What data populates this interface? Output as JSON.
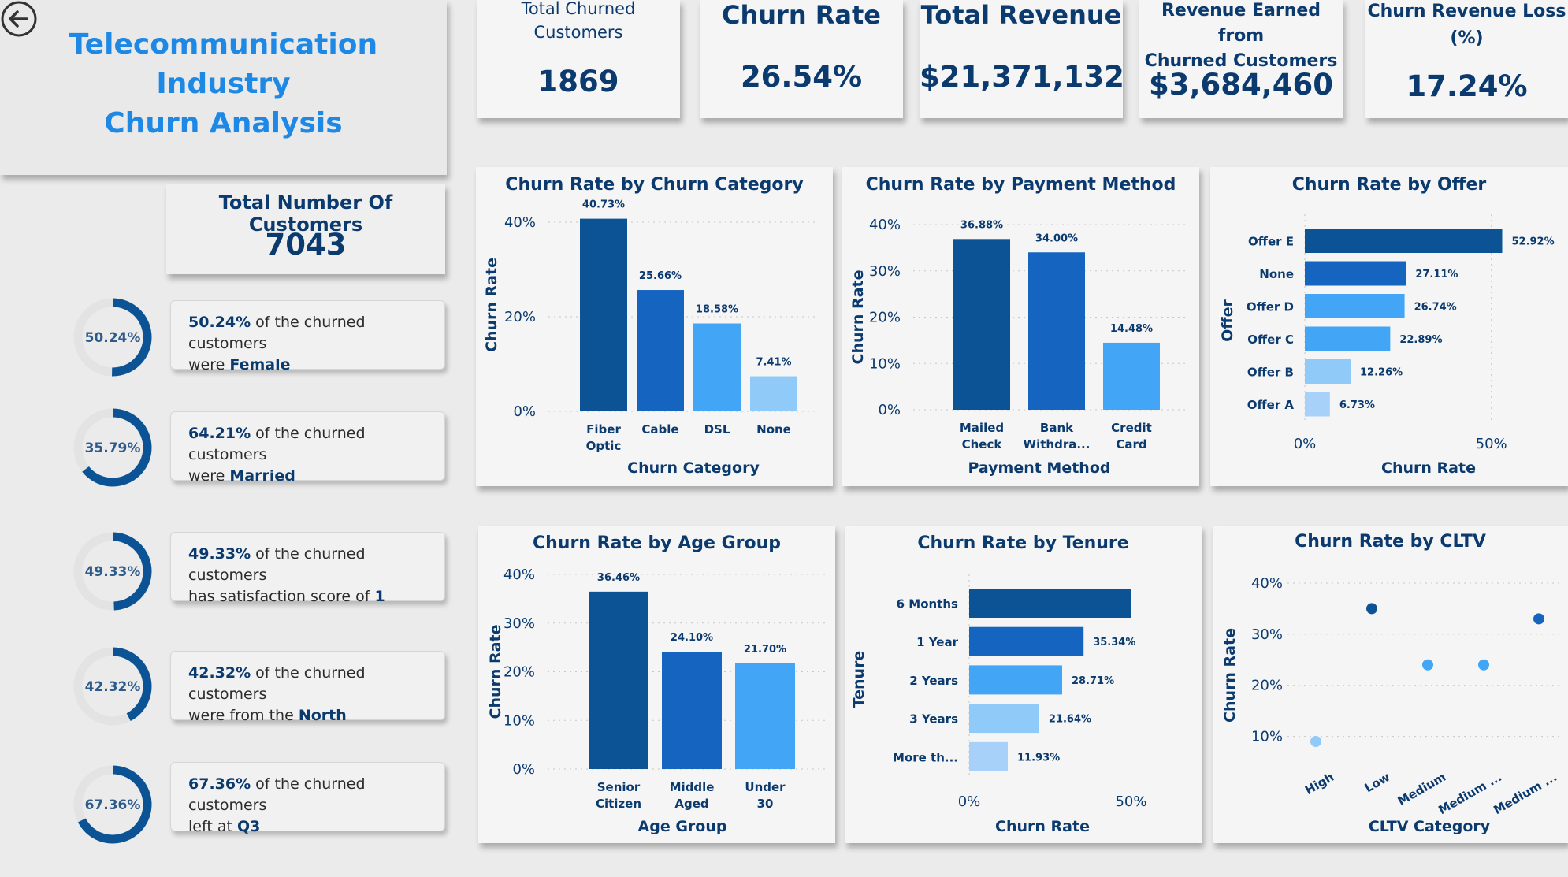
{
  "app": {
    "title_lines": [
      "Telecommunication",
      "Industry",
      "Churn Analysis"
    ]
  },
  "colors": {
    "c1": "#0b5394",
    "c2": "#1565c0",
    "c3": "#42a5f5",
    "c4": "#90caf9",
    "c5": "#a8d1fa",
    "ring": "#0b5394",
    "ring_track": "#e3e3e3",
    "title": "#1e88e5",
    "text": "#0b3a6e"
  },
  "kpis": [
    {
      "title": "Total Churned Customers",
      "title_lines": [
        "Total Churned",
        "Customers"
      ],
      "value": "1869"
    },
    {
      "title": "Churn Rate",
      "title_lines": [
        "Churn Rate"
      ],
      "value": "26.54%"
    },
    {
      "title": "Total Revenue",
      "title_lines": [
        "Total Revenue"
      ],
      "value": "$21,371,132"
    },
    {
      "title": "Revenue Earned from Churned Customers",
      "title_lines": [
        "Revenue Earned from",
        "Churned Customers"
      ],
      "value": "$3,684,460"
    },
    {
      "title": "Churn Revenue Loss (%)",
      "title_lines": [
        "Churn Revenue Loss",
        "(%)"
      ],
      "value": "17.24%"
    }
  ],
  "total_customers": {
    "title": "Total Number Of Customers",
    "value": "7043"
  },
  "insights": [
    {
      "ring_label": "50.24%",
      "ring_fraction": 0.5024,
      "pct": "50.24%",
      "text": "of the churned customers",
      "line2_prefix": "were",
      "highlight": "Female"
    },
    {
      "ring_label": "35.79%",
      "ring_fraction": 0.6421,
      "pct": "64.21%",
      "text": "of the churned customers",
      "line2_prefix": "were",
      "highlight": "Married"
    },
    {
      "ring_label": "49.33%",
      "ring_fraction": 0.4933,
      "pct": "49.33%",
      "text": "of the churned customers",
      "line2_prefix": "has satisfaction score of",
      "highlight": "1"
    },
    {
      "ring_label": "42.32%",
      "ring_fraction": 0.4232,
      "pct": "42.32%",
      "text": "of the churned customers",
      "line2_prefix": "were from the",
      "highlight": "North"
    },
    {
      "ring_label": "67.36%",
      "ring_fraction": 0.6736,
      "pct": "67.36%",
      "text": "of the churned customers",
      "line2_prefix": "left at",
      "highlight": "Q3"
    }
  ],
  "chart_data": [
    {
      "type": "bar",
      "title": "Churn Rate by Churn Category",
      "xlabel": "Churn Category",
      "ylabel": "Churn Rate",
      "categories": [
        "Fiber Optic",
        "Cable",
        "DSL",
        "None"
      ],
      "values": [
        40.73,
        25.66,
        18.58,
        7.41
      ],
      "data_labels": [
        "40.73%",
        "25.66%",
        "18.58%",
        "7.41%"
      ],
      "yticks": [
        "0%",
        "20%",
        "40%"
      ],
      "ylim": [
        0,
        45
      ]
    },
    {
      "type": "bar",
      "title": "Churn Rate by Payment Method",
      "xlabel": "Payment Method",
      "ylabel": "Churn Rate",
      "categories": [
        "Mailed Check",
        "Bank Withdra...",
        "Credit Card"
      ],
      "values": [
        36.88,
        34.0,
        14.48
      ],
      "data_labels": [
        "36.88%",
        "34.00%",
        "14.48%"
      ],
      "yticks": [
        "0%",
        "10%",
        "20%",
        "30%",
        "40%"
      ],
      "ylim": [
        0,
        40
      ]
    },
    {
      "type": "bar",
      "orientation": "horizontal",
      "title": "Churn Rate by Offer",
      "xlabel": "Churn Rate",
      "ylabel": "Offer",
      "categories": [
        "Offer E",
        "None",
        "Offer D",
        "Offer C",
        "Offer B",
        "Offer A"
      ],
      "values": [
        52.92,
        27.11,
        26.74,
        22.89,
        12.26,
        6.73
      ],
      "data_labels": [
        "52.92%",
        "27.11%",
        "26.74%",
        "22.89%",
        "12.26%",
        "6.73%"
      ],
      "xticks": [
        "0%",
        "50%"
      ],
      "xlim": [
        0,
        60
      ]
    },
    {
      "type": "bar",
      "title": "Churn Rate by Age Group",
      "xlabel": "Age Group",
      "ylabel": "Churn Rate",
      "categories": [
        "Senior Citizen",
        "Middle Aged",
        "Under 30"
      ],
      "values": [
        36.46,
        24.1,
        21.7
      ],
      "data_labels": [
        "36.46%",
        "24.10%",
        "21.70%"
      ],
      "yticks": [
        "0%",
        "10%",
        "20%",
        "30%",
        "40%"
      ],
      "ylim": [
        0,
        40
      ]
    },
    {
      "type": "bar",
      "orientation": "horizontal",
      "title": "Churn Rate by Tenure",
      "xlabel": "Churn Rate",
      "ylabel": "Tenure",
      "categories": [
        "6 Months",
        "1 Year",
        "2 Years",
        "3 Years",
        "More th..."
      ],
      "values": [
        50,
        35.34,
        28.71,
        21.64,
        11.93
      ],
      "data_labels": [
        "",
        "35.34%",
        "28.71%",
        "21.64%",
        "11.93%"
      ],
      "xticks": [
        "0%",
        "50%"
      ],
      "xlim": [
        0,
        55
      ]
    },
    {
      "type": "scatter",
      "title": "Churn Rate by CLTV",
      "xlabel": "CLTV Category",
      "ylabel": "Churn Rate",
      "categories": [
        "High",
        "Low",
        "Medium",
        "Medium ...",
        "Medium ..."
      ],
      "values": [
        9,
        35,
        24,
        24,
        33
      ],
      "yticks": [
        "10%",
        "20%",
        "30%",
        "40%"
      ],
      "ylim": [
        5,
        42
      ]
    }
  ]
}
